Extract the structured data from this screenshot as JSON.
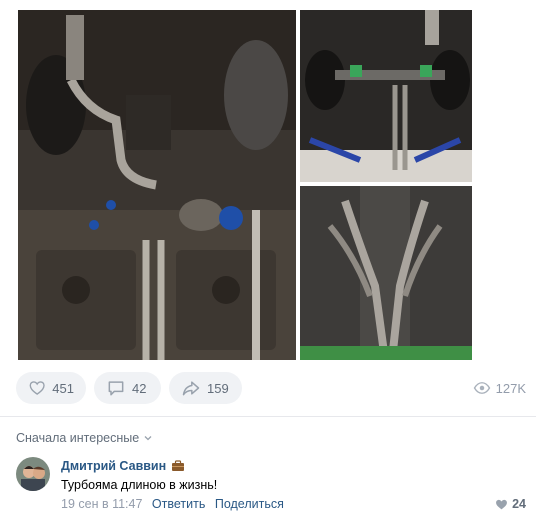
{
  "post": {
    "photos": [
      {
        "name": "turbo-exhaust-underbody-photo"
      },
      {
        "name": "car-on-lift-exhaust-photo"
      },
      {
        "name": "exhaust-headers-photo"
      }
    ]
  },
  "actions": {
    "like_count": "451",
    "comment_count": "42",
    "share_count": "159",
    "views": "127K"
  },
  "comments": {
    "sort_label": "Сначала интересные",
    "items": [
      {
        "author": "Дмитрий Саввин",
        "text": "Турбоямa длиною в жизнь!",
        "date": "19 сен в 11:47",
        "reply_label": "Ответить",
        "share_label": "Поделиться",
        "likes": "24"
      }
    ]
  },
  "colors": {
    "link": "#2a5885",
    "muted": "#939cab",
    "pill_bg": "#f0f2f5"
  }
}
